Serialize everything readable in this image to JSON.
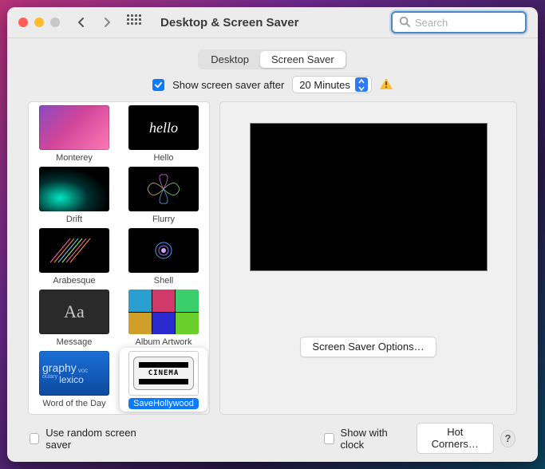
{
  "window": {
    "title": "Desktop & Screen Saver"
  },
  "toolbar": {
    "search_placeholder": "Search"
  },
  "tabs": {
    "desktop": "Desktop",
    "screensaver": "Screen Saver"
  },
  "after": {
    "label": "Show screen saver after",
    "value": "20 Minutes"
  },
  "savers": [
    {
      "label": "Monterey"
    },
    {
      "label": "Hello"
    },
    {
      "label": "Drift"
    },
    {
      "label": "Flurry"
    },
    {
      "label": "Arabesque"
    },
    {
      "label": "Shell"
    },
    {
      "label": "Message"
    },
    {
      "label": "Album Artwork"
    },
    {
      "label": "Word of the Day"
    },
    {
      "label": "SaveHollywood"
    }
  ],
  "cinema_text": "CINEMA",
  "word_thumb": {
    "line1": "graphy",
    "line2": "lexico",
    "line3": "voc",
    "line4": "oulary"
  },
  "message_thumb": "Aa",
  "options_button": "Screen Saver Options…",
  "footer": {
    "random": "Use random screen saver",
    "clock": "Show with clock",
    "hotcorners": "Hot Corners…",
    "help": "?"
  }
}
